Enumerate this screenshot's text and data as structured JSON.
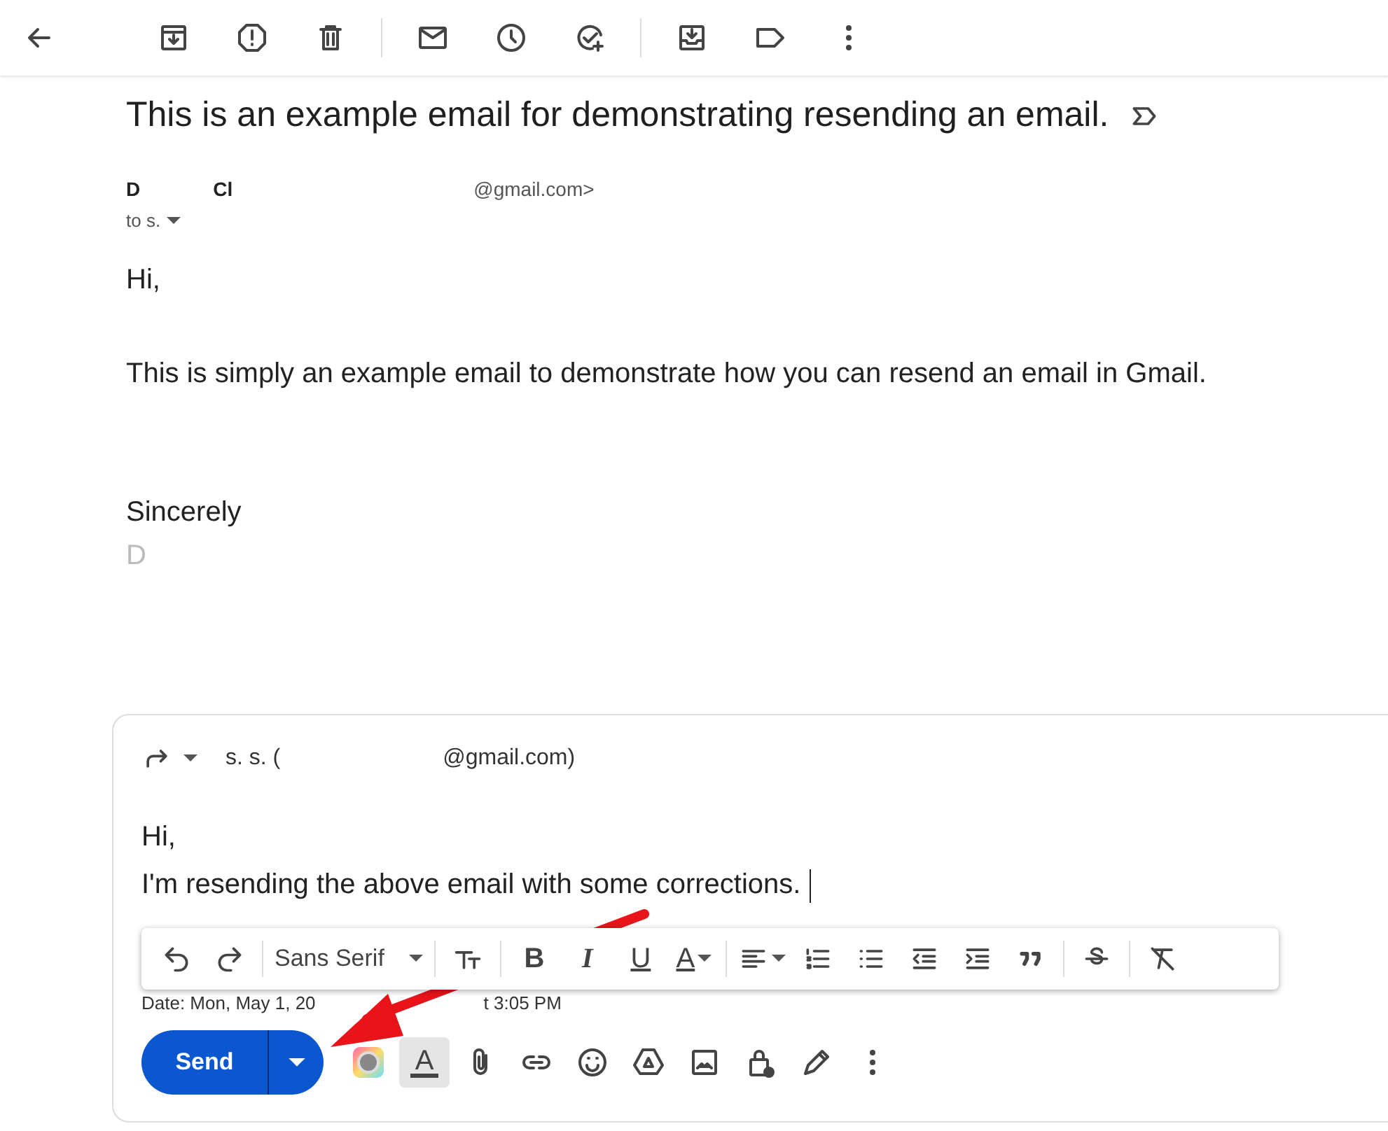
{
  "subject": "This is an example email for demonstrating resending an email.",
  "sender": {
    "name_first": "D",
    "name_last": "Cl",
    "email": "@gmail.com>",
    "to": "to s."
  },
  "body": [
    "Hi,",
    "This is simply an example email to demonstrate how you can resend an email in Gmail.",
    "Sincerely"
  ],
  "signature": "D",
  "compose": {
    "recipient_name": "s. s. (",
    "recipient_email": "@gmail.com)",
    "lines": [
      "Hi,",
      "I'm resending the above email with some corrections."
    ],
    "font": "Sans Serif",
    "bold": "B",
    "italic": "I",
    "underline": "U",
    "text_color": "A",
    "quoted_date": "Date: Mon, May 1, 20",
    "quoted_time": "t 3:05 PM",
    "send": "Send",
    "formatting_toggle": "A",
    "formatting_on": true
  }
}
